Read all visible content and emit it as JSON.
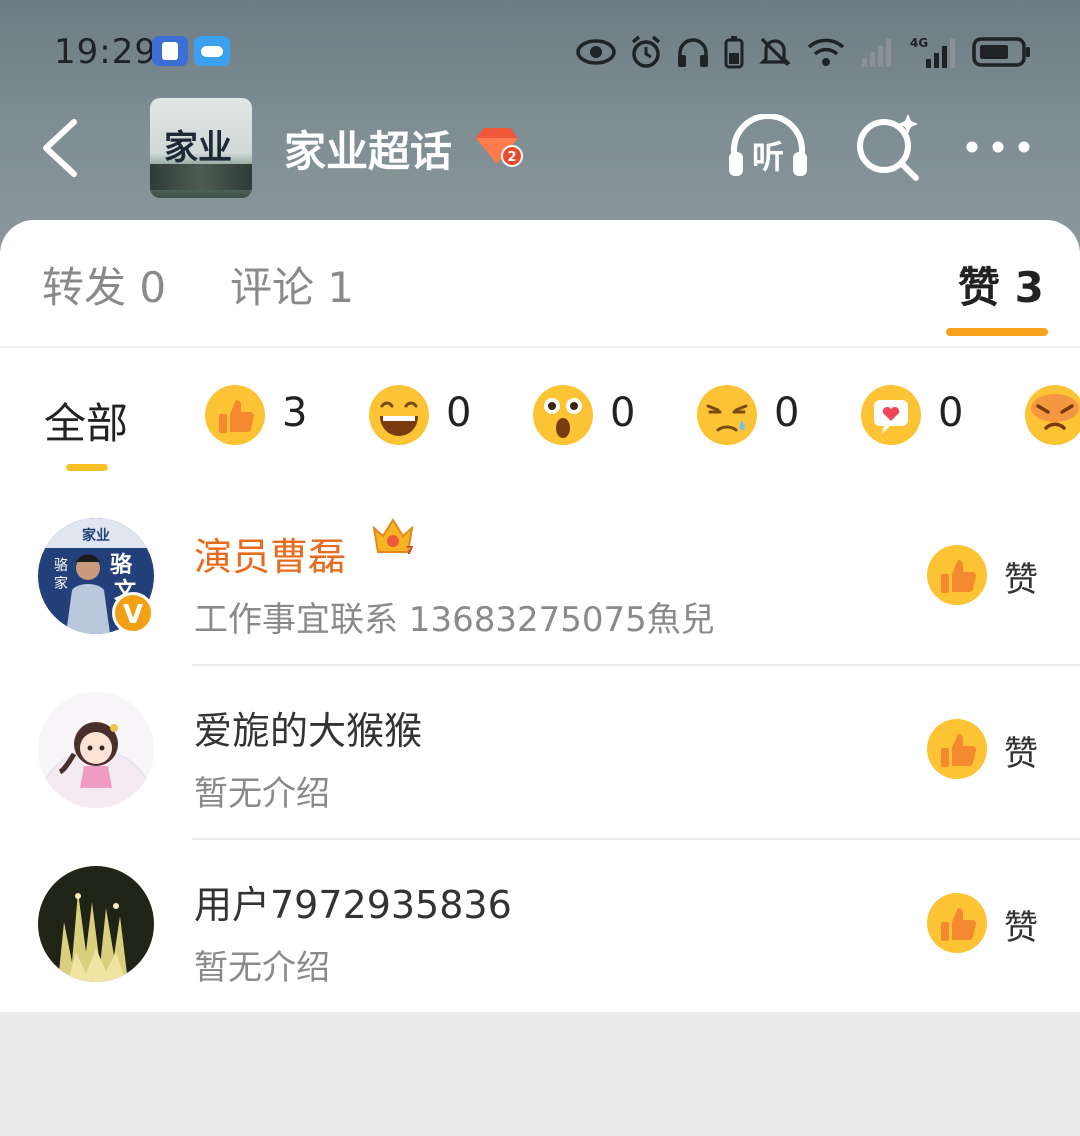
{
  "status_bar": {
    "time": "19:29",
    "icons": [
      "app-notification-icon",
      "cloud-icon",
      "eye-icon",
      "alarm-icon",
      "headphones-icon",
      "battery-saver-icon",
      "mute-icon",
      "wifi-icon",
      "signal-icon",
      "4g-signal-icon",
      "battery-icon"
    ],
    "network_label": "4G"
  },
  "header": {
    "group_name": "家业超话",
    "group_avatar_text": "家业",
    "group_level": "2",
    "listen_label": "听"
  },
  "tabs": [
    {
      "label": "转发 0",
      "active": false
    },
    {
      "label": "评论 1",
      "active": false
    },
    {
      "label": "赞 3",
      "active": true
    }
  ],
  "reactions": {
    "all_label": "全部",
    "items": [
      {
        "icon": "thumbs-up-emoji",
        "count": "3"
      },
      {
        "icon": "laughing-emoji",
        "count": "0"
      },
      {
        "icon": "surprised-emoji",
        "count": "0"
      },
      {
        "icon": "crying-emoji",
        "count": "0"
      },
      {
        "icon": "heart-emoji",
        "count": "0"
      },
      {
        "icon": "angry-emoji",
        "count": ""
      }
    ]
  },
  "users": [
    {
      "name": "演员曹磊",
      "bio": "工作事宜联系 13683275075魚兒",
      "like_label": "赞",
      "vip": true,
      "verified": true,
      "crown_level": "7",
      "avatar_text": "家业 骆家 骆文"
    },
    {
      "name": "爱旎的大猴猴",
      "bio": "暂无介绍",
      "like_label": "赞",
      "vip": false
    },
    {
      "name": "用户7972935836",
      "bio": "暂无介绍",
      "like_label": "赞",
      "vip": false
    }
  ],
  "colors": {
    "accent_orange": "#f7a21b",
    "vip_name": "#e86b1c",
    "header_bg": "#7d8d92"
  }
}
